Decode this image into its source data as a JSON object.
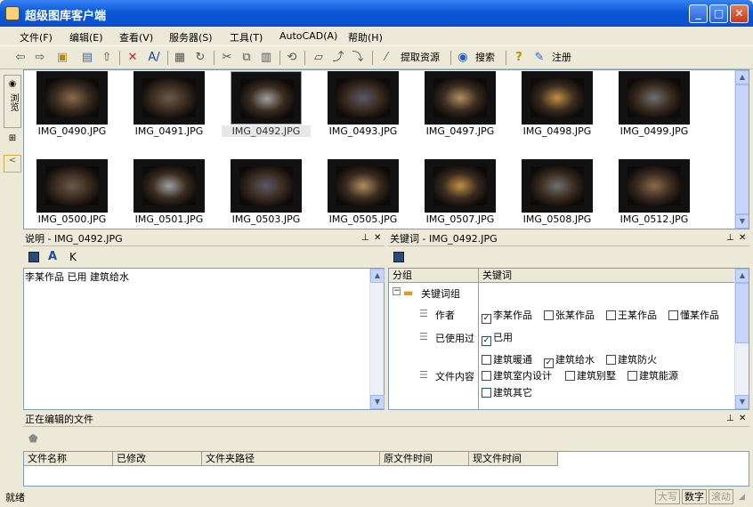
{
  "window": {
    "title": "超级图库客户端",
    "btn_min": "_",
    "btn_max": "□",
    "btn_close": "✕"
  },
  "menu": [
    "文件(F)",
    "编辑(E)",
    "查看(V)",
    "服务器(S)",
    "工具(T)",
    "AutoCAD(A)",
    "帮助(H)"
  ],
  "toolbar": {
    "fetch": "提取资源",
    "search": "搜索",
    "register": "注册"
  },
  "sidebar": {
    "browse": "浏览"
  },
  "gallery": {
    "row1": [
      "IMG_0490.JPG",
      "IMG_0491.JPG",
      "IMG_0492.JPG",
      "IMG_0493.JPG",
      "IMG_0497.JPG",
      "IMG_0498.JPG",
      "IMG_0499.JPG"
    ],
    "row2": [
      "IMG_0500.JPG",
      "IMG_0501.JPG",
      "IMG_0503.JPG",
      "IMG_0505.JPG",
      "IMG_0507.JPG",
      "IMG_0508.JPG",
      "IMG_0512.JPG"
    ],
    "selected": "IMG_0492.JPG"
  },
  "desc": {
    "title": "说明 - IMG_0492.JPG",
    "text": "李某作品 已用 建筑给水"
  },
  "keywords": {
    "title": "关键词 - IMG_0492.JPG",
    "col_group": "分组",
    "col_kw": "关键词",
    "root": "关键词组",
    "groups": [
      "作者",
      "已使用过",
      "文件内容"
    ],
    "author": [
      "李某作品",
      "张某作品",
      "王某作品",
      "懂某作品"
    ],
    "used": [
      "已用"
    ],
    "content1": [
      "建筑暖通",
      "建筑给水",
      "建筑防火"
    ],
    "content2": [
      "建筑室内设计",
      "建筑别墅",
      "建筑能源"
    ],
    "content3": [
      "建筑其它"
    ]
  },
  "editing": {
    "title": "正在编辑的文件",
    "cols": [
      "文件名称",
      "已修改",
      "文件夹路径",
      "原文件时间",
      "现文件时间"
    ]
  },
  "status": {
    "text": "就绪",
    "caps": "大写",
    "num": "数字",
    "scroll": "滚动"
  }
}
